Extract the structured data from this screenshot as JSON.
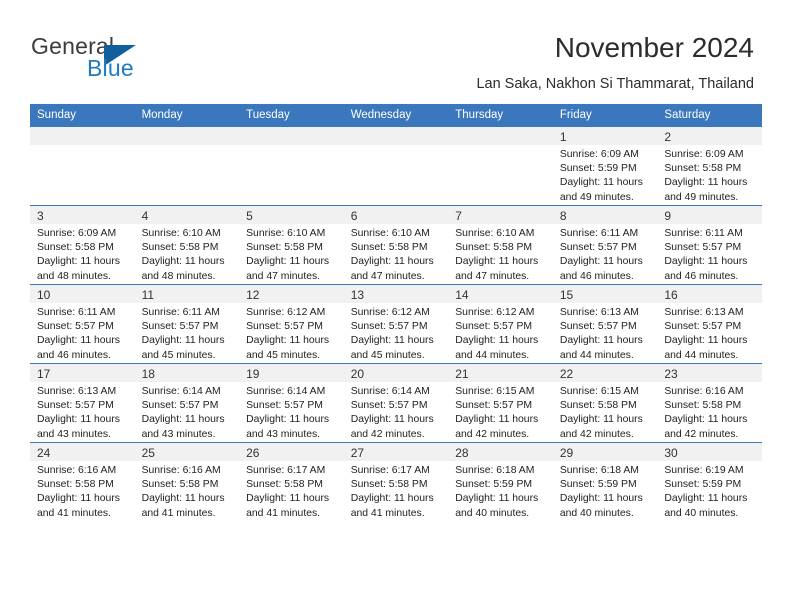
{
  "brand": {
    "name_part1": "General",
    "name_part2": "Blue",
    "color_primary": "#1f7ac0",
    "color_dark": "#3c3c3c"
  },
  "header": {
    "title": "November 2024",
    "subtitle": "Lan Saka, Nakhon Si Thammarat, Thailand"
  },
  "calendar": {
    "header_bg": "#3a77bd",
    "weekdays": [
      "Sunday",
      "Monday",
      "Tuesday",
      "Wednesday",
      "Thursday",
      "Friday",
      "Saturday"
    ],
    "weeks": [
      [
        {
          "day": "",
          "sunrise": "",
          "sunset": "",
          "daylight1": "",
          "daylight2": ""
        },
        {
          "day": "",
          "sunrise": "",
          "sunset": "",
          "daylight1": "",
          "daylight2": ""
        },
        {
          "day": "",
          "sunrise": "",
          "sunset": "",
          "daylight1": "",
          "daylight2": ""
        },
        {
          "day": "",
          "sunrise": "",
          "sunset": "",
          "daylight1": "",
          "daylight2": ""
        },
        {
          "day": "",
          "sunrise": "",
          "sunset": "",
          "daylight1": "",
          "daylight2": ""
        },
        {
          "day": "1",
          "sunrise": "Sunrise: 6:09 AM",
          "sunset": "Sunset: 5:59 PM",
          "daylight1": "Daylight: 11 hours",
          "daylight2": "and 49 minutes."
        },
        {
          "day": "2",
          "sunrise": "Sunrise: 6:09 AM",
          "sunset": "Sunset: 5:58 PM",
          "daylight1": "Daylight: 11 hours",
          "daylight2": "and 49 minutes."
        }
      ],
      [
        {
          "day": "3",
          "sunrise": "Sunrise: 6:09 AM",
          "sunset": "Sunset: 5:58 PM",
          "daylight1": "Daylight: 11 hours",
          "daylight2": "and 48 minutes."
        },
        {
          "day": "4",
          "sunrise": "Sunrise: 6:10 AM",
          "sunset": "Sunset: 5:58 PM",
          "daylight1": "Daylight: 11 hours",
          "daylight2": "and 48 minutes."
        },
        {
          "day": "5",
          "sunrise": "Sunrise: 6:10 AM",
          "sunset": "Sunset: 5:58 PM",
          "daylight1": "Daylight: 11 hours",
          "daylight2": "and 47 minutes."
        },
        {
          "day": "6",
          "sunrise": "Sunrise: 6:10 AM",
          "sunset": "Sunset: 5:58 PM",
          "daylight1": "Daylight: 11 hours",
          "daylight2": "and 47 minutes."
        },
        {
          "day": "7",
          "sunrise": "Sunrise: 6:10 AM",
          "sunset": "Sunset: 5:58 PM",
          "daylight1": "Daylight: 11 hours",
          "daylight2": "and 47 minutes."
        },
        {
          "day": "8",
          "sunrise": "Sunrise: 6:11 AM",
          "sunset": "Sunset: 5:57 PM",
          "daylight1": "Daylight: 11 hours",
          "daylight2": "and 46 minutes."
        },
        {
          "day": "9",
          "sunrise": "Sunrise: 6:11 AM",
          "sunset": "Sunset: 5:57 PM",
          "daylight1": "Daylight: 11 hours",
          "daylight2": "and 46 minutes."
        }
      ],
      [
        {
          "day": "10",
          "sunrise": "Sunrise: 6:11 AM",
          "sunset": "Sunset: 5:57 PM",
          "daylight1": "Daylight: 11 hours",
          "daylight2": "and 46 minutes."
        },
        {
          "day": "11",
          "sunrise": "Sunrise: 6:11 AM",
          "sunset": "Sunset: 5:57 PM",
          "daylight1": "Daylight: 11 hours",
          "daylight2": "and 45 minutes."
        },
        {
          "day": "12",
          "sunrise": "Sunrise: 6:12 AM",
          "sunset": "Sunset: 5:57 PM",
          "daylight1": "Daylight: 11 hours",
          "daylight2": "and 45 minutes."
        },
        {
          "day": "13",
          "sunrise": "Sunrise: 6:12 AM",
          "sunset": "Sunset: 5:57 PM",
          "daylight1": "Daylight: 11 hours",
          "daylight2": "and 45 minutes."
        },
        {
          "day": "14",
          "sunrise": "Sunrise: 6:12 AM",
          "sunset": "Sunset: 5:57 PM",
          "daylight1": "Daylight: 11 hours",
          "daylight2": "and 44 minutes."
        },
        {
          "day": "15",
          "sunrise": "Sunrise: 6:13 AM",
          "sunset": "Sunset: 5:57 PM",
          "daylight1": "Daylight: 11 hours",
          "daylight2": "and 44 minutes."
        },
        {
          "day": "16",
          "sunrise": "Sunrise: 6:13 AM",
          "sunset": "Sunset: 5:57 PM",
          "daylight1": "Daylight: 11 hours",
          "daylight2": "and 44 minutes."
        }
      ],
      [
        {
          "day": "17",
          "sunrise": "Sunrise: 6:13 AM",
          "sunset": "Sunset: 5:57 PM",
          "daylight1": "Daylight: 11 hours",
          "daylight2": "and 43 minutes."
        },
        {
          "day": "18",
          "sunrise": "Sunrise: 6:14 AM",
          "sunset": "Sunset: 5:57 PM",
          "daylight1": "Daylight: 11 hours",
          "daylight2": "and 43 minutes."
        },
        {
          "day": "19",
          "sunrise": "Sunrise: 6:14 AM",
          "sunset": "Sunset: 5:57 PM",
          "daylight1": "Daylight: 11 hours",
          "daylight2": "and 43 minutes."
        },
        {
          "day": "20",
          "sunrise": "Sunrise: 6:14 AM",
          "sunset": "Sunset: 5:57 PM",
          "daylight1": "Daylight: 11 hours",
          "daylight2": "and 42 minutes."
        },
        {
          "day": "21",
          "sunrise": "Sunrise: 6:15 AM",
          "sunset": "Sunset: 5:57 PM",
          "daylight1": "Daylight: 11 hours",
          "daylight2": "and 42 minutes."
        },
        {
          "day": "22",
          "sunrise": "Sunrise: 6:15 AM",
          "sunset": "Sunset: 5:58 PM",
          "daylight1": "Daylight: 11 hours",
          "daylight2": "and 42 minutes."
        },
        {
          "day": "23",
          "sunrise": "Sunrise: 6:16 AM",
          "sunset": "Sunset: 5:58 PM",
          "daylight1": "Daylight: 11 hours",
          "daylight2": "and 42 minutes."
        }
      ],
      [
        {
          "day": "24",
          "sunrise": "Sunrise: 6:16 AM",
          "sunset": "Sunset: 5:58 PM",
          "daylight1": "Daylight: 11 hours",
          "daylight2": "and 41 minutes."
        },
        {
          "day": "25",
          "sunrise": "Sunrise: 6:16 AM",
          "sunset": "Sunset: 5:58 PM",
          "daylight1": "Daylight: 11 hours",
          "daylight2": "and 41 minutes."
        },
        {
          "day": "26",
          "sunrise": "Sunrise: 6:17 AM",
          "sunset": "Sunset: 5:58 PM",
          "daylight1": "Daylight: 11 hours",
          "daylight2": "and 41 minutes."
        },
        {
          "day": "27",
          "sunrise": "Sunrise: 6:17 AM",
          "sunset": "Sunset: 5:58 PM",
          "daylight1": "Daylight: 11 hours",
          "daylight2": "and 41 minutes."
        },
        {
          "day": "28",
          "sunrise": "Sunrise: 6:18 AM",
          "sunset": "Sunset: 5:59 PM",
          "daylight1": "Daylight: 11 hours",
          "daylight2": "and 40 minutes."
        },
        {
          "day": "29",
          "sunrise": "Sunrise: 6:18 AM",
          "sunset": "Sunset: 5:59 PM",
          "daylight1": "Daylight: 11 hours",
          "daylight2": "and 40 minutes."
        },
        {
          "day": "30",
          "sunrise": "Sunrise: 6:19 AM",
          "sunset": "Sunset: 5:59 PM",
          "daylight1": "Daylight: 11 hours",
          "daylight2": "and 40 minutes."
        }
      ]
    ]
  }
}
